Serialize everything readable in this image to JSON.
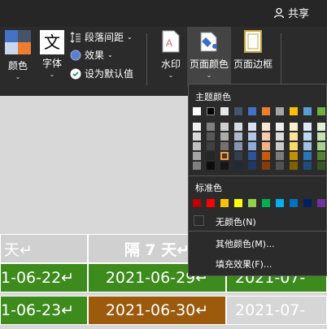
{
  "topbar": {
    "share_label": "共享"
  },
  "ribbon": {
    "colors_label": "颜色",
    "fonts_label": "字体",
    "fonts_glyph": "文",
    "paragraph_spacing_label": "段落间距",
    "effects_label": "效果",
    "set_default_label": "设为默认值",
    "watermark_label": "水印",
    "page_color_label": "页面颜色",
    "page_borders_label": "页面边框"
  },
  "table": {
    "header": [
      "天↵",
      "隔 7 天↵"
    ],
    "rows": [
      [
        "1-06-22↵",
        "2021-06-29↵",
        "2021-07-"
      ],
      [
        "1-06-23↵",
        "2021-06-30↵",
        "2021-07-"
      ]
    ]
  },
  "popup": {
    "theme_colors_title": "主题颜色",
    "standard_colors_title": "标准色",
    "no_color_label": "无颜色(N)",
    "more_colors_label": "其他颜色(M)...",
    "fill_effects_label": "填充效果(F)...",
    "theme_base": [
      "#ffffff",
      "#000000",
      "#e7e6e6",
      "#44546a",
      "#4472c4",
      "#ed7d31",
      "#a5a5a5",
      "#ffc000",
      "#5b9bd5",
      "#70ad47"
    ],
    "theme_shades": [
      [
        "#f2f2f2",
        "#d9d9d9",
        "#bfbfbf",
        "#a6a6a6",
        "#808080"
      ],
      [
        "#808080",
        "#595959",
        "#404040",
        "#262626",
        "#0d0d0d"
      ],
      [
        "#d0cece",
        "#aeabab",
        "#757171",
        "#3a3838",
        "#171616"
      ],
      [
        "#d6dce4",
        "#adb9ca",
        "#8496b0",
        "#333f4f",
        "#222a35"
      ],
      [
        "#d9e2f3",
        "#b4c6e7",
        "#8eaadb",
        "#2f5496",
        "#1f3864"
      ],
      [
        "#fbe5d5",
        "#f7cbac",
        "#f4b183",
        "#c55a11",
        "#833c0b"
      ],
      [
        "#ededed",
        "#dbdbdb",
        "#c9c9c9",
        "#7b7b7b",
        "#525252"
      ],
      [
        "#fff2cc",
        "#fee599",
        "#ffd965",
        "#bf9000",
        "#7f6000"
      ],
      [
        "#deebf6",
        "#bdd7ee",
        "#9cc3e5",
        "#2e75b5",
        "#1e4e79"
      ],
      [
        "#e2efd9",
        "#c5e0b3",
        "#a8d08d",
        "#538135",
        "#375623"
      ]
    ],
    "standard": [
      "#c00000",
      "#ff0000",
      "#ffc000",
      "#ffff00",
      "#92d050",
      "#00b050",
      "#00b0f0",
      "#0070c0",
      "#002060",
      "#7030a0"
    ]
  }
}
